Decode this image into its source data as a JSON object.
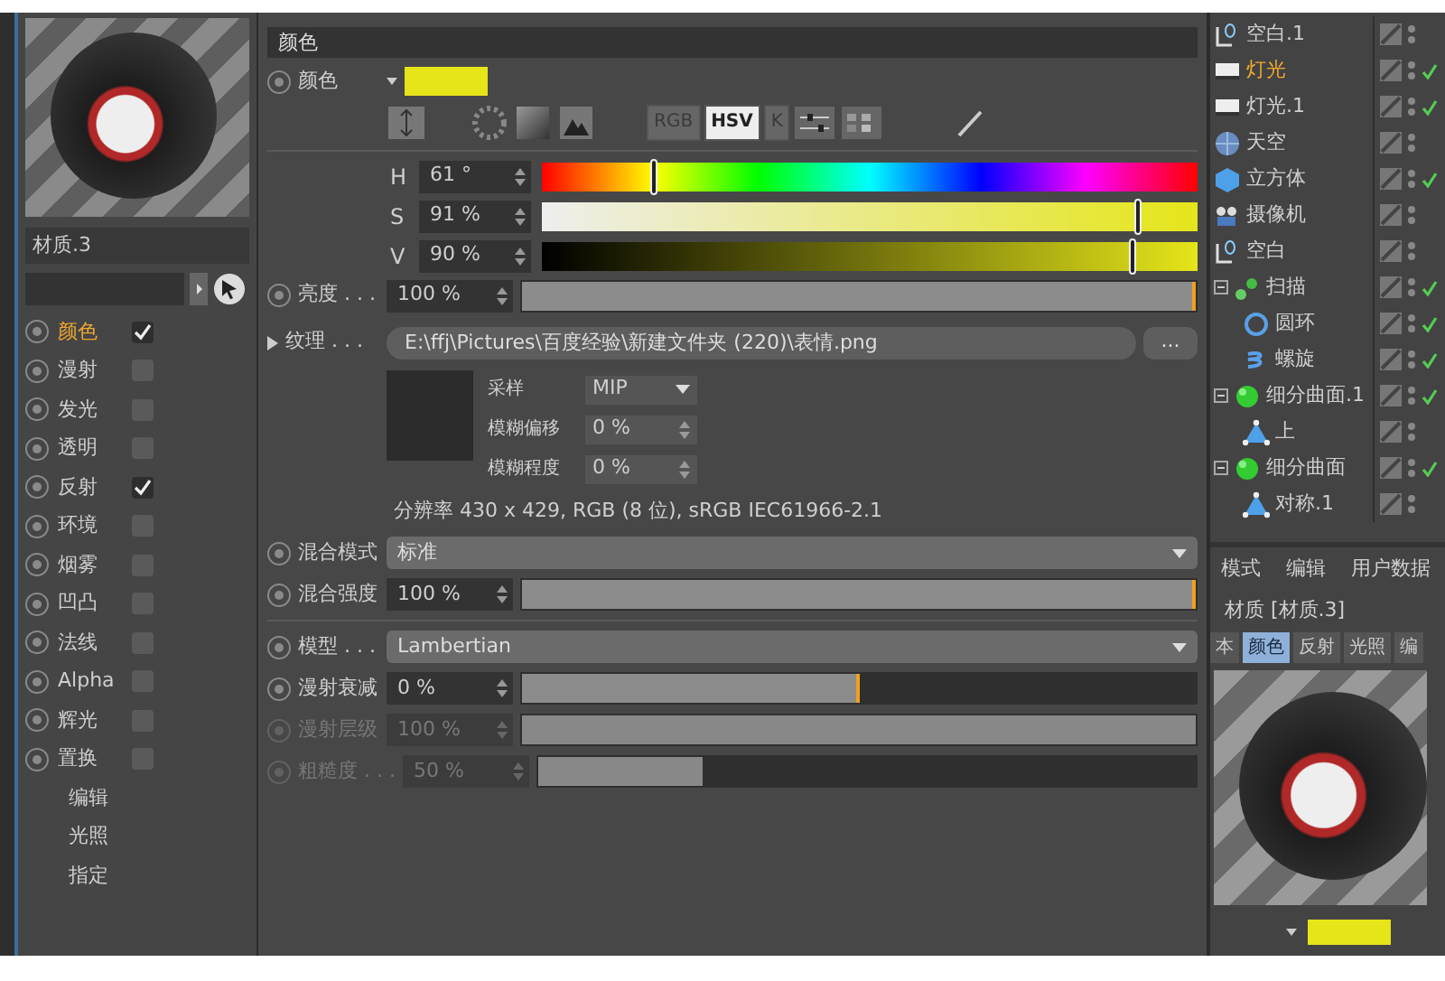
{
  "material": {
    "name": "材质.3"
  },
  "channels": [
    {
      "kind": "toggle",
      "label": "颜色",
      "checked": true,
      "selected": true
    },
    {
      "kind": "toggle",
      "label": "漫射",
      "checked": false,
      "selected": false
    },
    {
      "kind": "toggle",
      "label": "发光",
      "checked": false,
      "selected": false
    },
    {
      "kind": "toggle",
      "label": "透明",
      "checked": false,
      "selected": false
    },
    {
      "kind": "toggle",
      "label": "反射",
      "checked": true,
      "selected": false
    },
    {
      "kind": "toggle",
      "label": "环境",
      "checked": false,
      "selected": false
    },
    {
      "kind": "toggle",
      "label": "烟雾",
      "checked": false,
      "selected": false
    },
    {
      "kind": "toggle",
      "label": "凹凸",
      "checked": false,
      "selected": false
    },
    {
      "kind": "toggle",
      "label": "法线",
      "checked": false,
      "selected": false
    },
    {
      "kind": "toggle",
      "label": "Alpha",
      "checked": false,
      "selected": false
    },
    {
      "kind": "toggle",
      "label": "辉光",
      "checked": false,
      "selected": false
    },
    {
      "kind": "toggle",
      "label": "置换",
      "checked": false,
      "selected": false
    },
    {
      "kind": "page",
      "label": "编辑",
      "selected": false
    },
    {
      "kind": "page",
      "label": "光照",
      "selected": false
    },
    {
      "kind": "page",
      "label": "指定",
      "selected": false
    }
  ],
  "section_title": "颜色",
  "color": {
    "label": "颜色",
    "modes": [
      {
        "label": "RGB",
        "selected": false
      },
      {
        "label": "HSV",
        "selected": true
      },
      {
        "label": "K",
        "selected": false
      }
    ],
    "sliders": [
      {
        "kind": "hue",
        "label": "H",
        "value": "61 °",
        "level": 0.17
      },
      {
        "kind": "saturation",
        "label": "S",
        "value": "91 %",
        "level": 0.91
      },
      {
        "kind": "value",
        "label": "V",
        "value": "90 %",
        "level": 0.9
      }
    ]
  },
  "brightness": {
    "label": "亮度 . . .",
    "value": "100 %",
    "level": 1
  },
  "texture": {
    "label": "纹理 . . .",
    "path": "E:\\ffj\\Pictures\\百度经验\\新建文件夹 (220)\\表情.png",
    "browse": "...",
    "fields": [
      {
        "kind": "dropdown",
        "label": "采样",
        "value": "MIP"
      },
      {
        "kind": "number",
        "label": "模糊偏移",
        "value": "0 %"
      },
      {
        "kind": "number",
        "label": "模糊程度",
        "value": "0 %"
      }
    ],
    "info": "分辨率 430 x 429, RGB (8 位), sRGB IEC61966-2.1"
  },
  "blend": [
    {
      "kind": "dropdown",
      "label": "混合模式",
      "value": "标准",
      "disabled": false
    },
    {
      "kind": "slider",
      "label": "混合强度",
      "value": "100 %",
      "level": 1,
      "disabled": false
    }
  ],
  "model": [
    {
      "kind": "dropdown",
      "label": "模型 . . .",
      "value": "Lambertian",
      "disabled": false
    },
    {
      "kind": "slider",
      "label": "漫射衰减",
      "value": "0 %",
      "level": 0.5,
      "disabled": false
    },
    {
      "kind": "slider",
      "label": "漫射层级",
      "value": "100 %",
      "level": 1,
      "disabled": true
    },
    {
      "kind": "slider",
      "label": "粗糙度 . . .",
      "value": "50 %",
      "level": 0.25,
      "disabled": true
    }
  ],
  "objects": [
    {
      "kind": "null",
      "name": "空白.1",
      "selected": false,
      "checked": false
    },
    {
      "kind": "light",
      "name": "灯光",
      "selected": true,
      "checked": true
    },
    {
      "kind": "light",
      "name": "灯光.1",
      "selected": false,
      "checked": true
    },
    {
      "kind": "sky",
      "name": "天空",
      "selected": false,
      "checked": false
    },
    {
      "kind": "cube",
      "name": "立方体",
      "selected": false,
      "checked": true
    },
    {
      "kind": "camera",
      "name": "摄像机",
      "selected": false,
      "checked": false
    },
    {
      "kind": "null",
      "name": "空白",
      "selected": false,
      "checked": false
    },
    {
      "kind": "sweep",
      "name": "扫描",
      "selected": false,
      "checked": true,
      "expanded": true,
      "children": [
        {
          "kind": "circle",
          "name": "圆环",
          "selected": false,
          "checked": true
        },
        {
          "kind": "helix",
          "name": "螺旋",
          "selected": false,
          "checked": true
        }
      ]
    },
    {
      "kind": "subdiv",
      "name": "细分曲面.1",
      "selected": false,
      "checked": true,
      "expanded": true,
      "children": [
        {
          "kind": "polygon",
          "name": "上",
          "selected": false,
          "checked": false
        }
      ]
    },
    {
      "kind": "subdiv",
      "name": "细分曲面",
      "selected": false,
      "checked": true,
      "expanded": true,
      "children": [
        {
          "kind": "polygon",
          "name": "对称.1",
          "selected": false,
          "checked": false
        }
      ]
    }
  ],
  "attributes": {
    "menu": [
      "模式",
      "编辑",
      "用户数据"
    ],
    "title": "材质 [材质.3]",
    "tabs": [
      {
        "label": "本",
        "selected": false
      },
      {
        "label": "颜色",
        "selected": true
      },
      {
        "label": "反射",
        "selected": false
      },
      {
        "label": "光照",
        "selected": false
      },
      {
        "label": "编",
        "selected": false
      }
    ]
  }
}
